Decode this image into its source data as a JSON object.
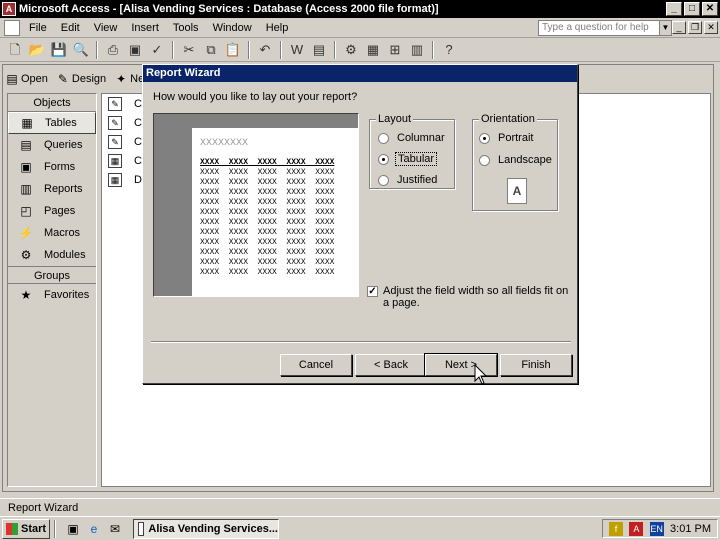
{
  "window": {
    "title": "Microsoft Access - [Alisa Vending Services : Database (Access 2000 file format)]",
    "icon": "access-app-icon",
    "controls": [
      "_",
      "□",
      "✕"
    ]
  },
  "menubar": {
    "items": [
      "File",
      "Edit",
      "View",
      "Insert",
      "Tools",
      "Window",
      "Help"
    ],
    "help_placeholder": "Type a question for help"
  },
  "db_toolbar": {
    "open": "Open",
    "design": "Design",
    "new": "New"
  },
  "objects_pane": {
    "header": "Objects",
    "items": [
      {
        "label": "Tables",
        "icon": "table-icon",
        "selected": true
      },
      {
        "label": "Queries",
        "icon": "query-icon"
      },
      {
        "label": "Forms",
        "icon": "form-icon"
      },
      {
        "label": "Reports",
        "icon": "report-icon"
      },
      {
        "label": "Pages",
        "icon": "page-icon"
      },
      {
        "label": "Macros",
        "icon": "macro-icon"
      },
      {
        "label": "Modules",
        "icon": "module-icon"
      }
    ],
    "groups_header": "Groups",
    "favorites": "Favorites"
  },
  "list_items": [
    "Cr",
    "Cr",
    "Cr",
    "Cu",
    "Dr"
  ],
  "wizard": {
    "title": "Report Wizard",
    "question": "How would you like to lay out your report?",
    "preview_title": "XXXXXXXX",
    "preview_header": "XXXX  XXXX  XXXX  XXXX  XXXX",
    "preview_row": "XXXX  XXXX  XXXX  XXXX  XXXX",
    "layout_label": "Layout",
    "layout_options": [
      "Columnar",
      "Tabular",
      "Justified"
    ],
    "layout_selected": "Tabular",
    "orientation_label": "Orientation",
    "orientation_options": [
      "Portrait",
      "Landscape"
    ],
    "orientation_selected": "Portrait",
    "orientation_thumb": "A",
    "adjust_label": "Adjust the field width so all fields fit on a page.",
    "adjust_checked": true,
    "buttons": {
      "cancel": "Cancel",
      "back": "< Back",
      "next": "Next >",
      "finish": "Finish"
    }
  },
  "statusbar": {
    "text": "Report Wizard"
  },
  "taskbar": {
    "start": "Start",
    "task": "Alisa Vending Services...",
    "clock": "3:01 PM",
    "tray_lang": "EN"
  }
}
